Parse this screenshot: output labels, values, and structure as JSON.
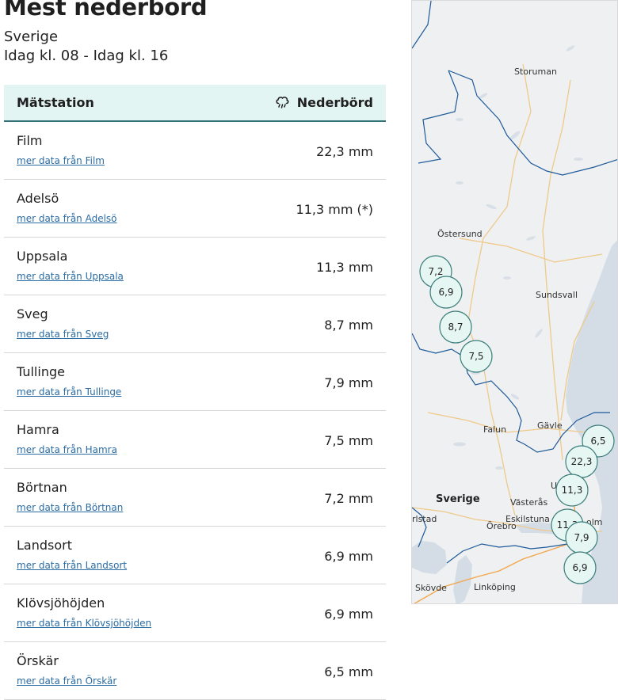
{
  "page": {
    "title": "Mest nederbörd",
    "region": "Sverige",
    "period": "Idag kl. 08 - Idag kl. 16"
  },
  "table": {
    "col_station": "Mätstation",
    "col_value": "Nederbörd",
    "col_value_icon": "rain-cloud-icon",
    "rows": [
      {
        "name": "Film",
        "link": "mer data från Film",
        "value": "22,3 mm"
      },
      {
        "name": "Adelsö",
        "link": "mer data från Adelsö",
        "value": "11,3 mm (*)"
      },
      {
        "name": "Uppsala",
        "link": "mer data från Uppsala",
        "value": "11,3 mm"
      },
      {
        "name": "Sveg",
        "link": "mer data från Sveg",
        "value": "8,7 mm"
      },
      {
        "name": "Tullinge",
        "link": "mer data från Tullinge",
        "value": "7,9 mm"
      },
      {
        "name": "Hamra",
        "link": "mer data från Hamra",
        "value": "7,5 mm"
      },
      {
        "name": "Börtnan",
        "link": "mer data från Börtnan",
        "value": "7,2 mm"
      },
      {
        "name": "Landsort",
        "link": "mer data från Landsort",
        "value": "6,9 mm"
      },
      {
        "name": "Klövsjöhöjden",
        "link": "mer data från Klövsjöhöjden",
        "value": "6,9 mm"
      },
      {
        "name": "Örskär",
        "link": "mer data från Örskär",
        "value": "6,5 mm"
      }
    ]
  },
  "map": {
    "places": {
      "storuman": "Storuman",
      "ostersund": "Östersund",
      "sundsvall": "Sundsvall",
      "falun": "Falun",
      "gavle": "Gävle",
      "sverige": "Sverige",
      "vasteras": "Västerås",
      "karlstad": "rlstad",
      "orebro": "Örebro",
      "eskilstuna": "Eskilstuna",
      "stockholm": "olm",
      "uppsala": "U",
      "skovde": "Skövde",
      "linkoping": "Linköping"
    },
    "markers": {
      "m1": "7,2",
      "m2": "6,9",
      "m3": "8,7",
      "m4": "7,5",
      "m5": "6,5",
      "m6": "22,3",
      "m7": "11,3",
      "m8": "11,3",
      "m9": "7,9",
      "m10": "6,9"
    },
    "colors": {
      "land": "#eef0f1",
      "water": "#d4dde6",
      "border": "#1f5a9a",
      "road": "#f0c98a",
      "marker_fill": "#e6f7f3",
      "marker_stroke": "#3a7d7b"
    }
  }
}
